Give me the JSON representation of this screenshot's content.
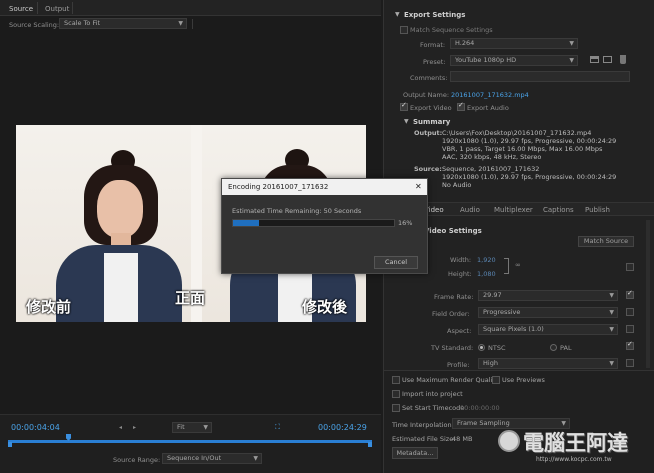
{
  "left": {
    "tabs": [
      "Source",
      "Output"
    ],
    "source_scaling_label": "Source Scaling:",
    "source_scaling_value": "Scale To Fit",
    "captions": {
      "left": "修改前",
      "center": "正面",
      "right": "修改後"
    },
    "timecode_start": "00:00:04:04",
    "timecode_end": "00:00:24:29",
    "fit_value": "Fit",
    "source_range_label": "Source Range:",
    "source_range_value": "Sequence In/Out"
  },
  "dialog": {
    "title": "Encoding 20161007_171632",
    "close": "✕",
    "remaining": "Estimated Time Remaining: 50 Seconds",
    "progress": 0.16,
    "percent_label": "16%",
    "cancel": "Cancel"
  },
  "export": {
    "header": "Export Settings",
    "match_sequence": "Match Sequence Settings",
    "format_label": "Format:",
    "format_value": "H.264",
    "preset_label": "Preset:",
    "preset_value": "YouTube 1080p HD",
    "comments_label": "Comments:",
    "output_name_label": "Output Name:",
    "output_name_value": "20161007_171632.mp4",
    "export_video": "Export Video",
    "export_audio": "Export Audio",
    "summary_header": "Summary",
    "output_label": "Output:",
    "output_lines": [
      "C:\\Users\\Fox\\Desktop\\20161007_171632.mp4",
      "1920x1080 (1.0), 29.97 fps, Progressive, 00:00:24:29",
      "VBR, 1 pass, Target 16.00 Mbps, Max 16.00 Mbps",
      "AAC, 320 kbps, 48 kHz, Stereo"
    ],
    "source_label": "Source:",
    "source_lines": [
      "Sequence, 20161007_171632",
      "1920x1080 (1.0), 29.97 fps, Progressive, 00:00:24:29",
      "No Audio"
    ]
  },
  "tabs2": [
    "Video",
    "Audio",
    "Multiplexer",
    "Captions",
    "Publish"
  ],
  "video": {
    "header": "Video Settings",
    "match_source": "Match Source",
    "width_label": "Width:",
    "width_value": "1,920",
    "height_label": "Height:",
    "height_value": "1,080",
    "frame_rate_label": "Frame Rate:",
    "frame_rate_value": "29.97",
    "field_order_label": "Field Order:",
    "field_order_value": "Progressive",
    "aspect_label": "Aspect:",
    "aspect_value": "Square Pixels (1.0)",
    "tv_standard_label": "TV Standard:",
    "ntsc": "NTSC",
    "pal": "PAL",
    "profile_label": "Profile:",
    "profile_value": "High"
  },
  "bottom": {
    "max_render": "Use Maximum Render Quality",
    "use_previews": "Use Previews",
    "import_project": "Import into project",
    "set_start_tc": "Set Start Timecode",
    "start_tc_value": "00:00:00:00",
    "time_interp_label": "Time Interpolation:",
    "time_interp_value": "Frame Sampling",
    "est_size_label": "Estimated File Size:",
    "est_size_value": "48 MB",
    "metadata": "Metadata...",
    "watermark": "電腦王阿達",
    "watermark_url": "http://www.kocpc.com.tw"
  },
  "colors": {
    "accent": "#2a7fd4",
    "progress": "#1f6fbf"
  }
}
